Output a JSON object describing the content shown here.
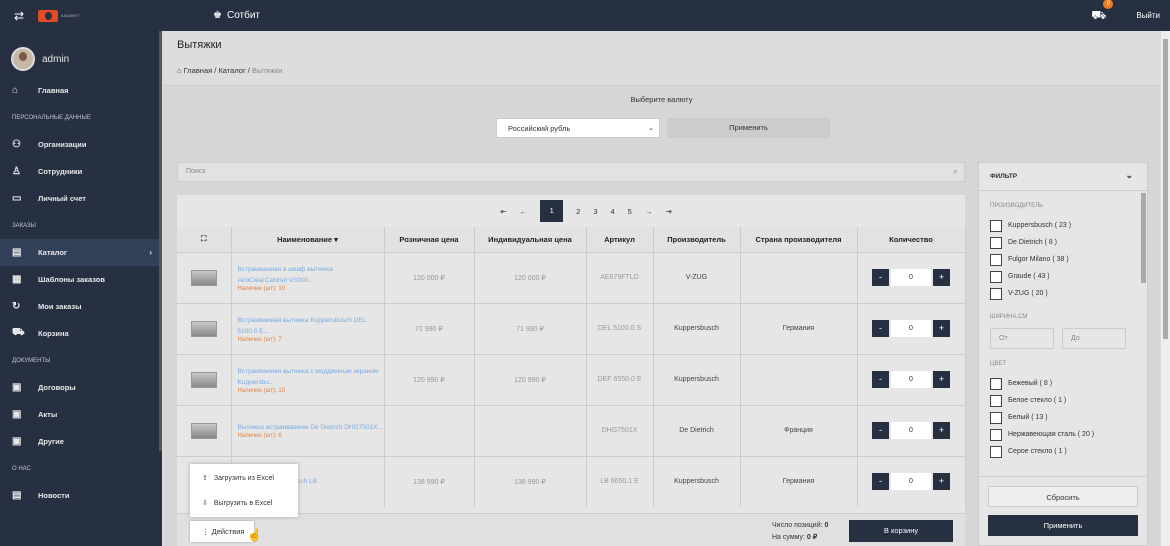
{
  "header": {
    "logo_text": "КАБИНЕТ",
    "company": "Сотбит",
    "cart_count": "0",
    "logout": "Выйти"
  },
  "sidebar": {
    "user": "admin",
    "items": [
      {
        "type": "item",
        "icon": "home-icon",
        "glyph": "⌂",
        "label": "Главная"
      },
      {
        "type": "section",
        "label": "ПЕРСОНАЛЬНЫЕ ДАННЫЕ"
      },
      {
        "type": "item",
        "icon": "org-icon",
        "glyph": "⚇",
        "label": "Организации"
      },
      {
        "type": "item",
        "icon": "person-icon",
        "glyph": "♙",
        "label": "Сотрудники"
      },
      {
        "type": "item",
        "icon": "card-icon",
        "glyph": "▭",
        "label": "Личный счет"
      },
      {
        "type": "section",
        "label": "ЗАКАЗЫ"
      },
      {
        "type": "item",
        "icon": "catalog-icon",
        "glyph": "▤",
        "label": "Каталог",
        "active": true
      },
      {
        "type": "item",
        "icon": "grid-icon",
        "glyph": "▦",
        "label": "Шаблоны заказов"
      },
      {
        "type": "item",
        "icon": "refresh-icon",
        "glyph": "↻",
        "label": "Мои заказы"
      },
      {
        "type": "item",
        "icon": "cart-icon",
        "glyph": "⛟",
        "label": "Корзина"
      },
      {
        "type": "section",
        "label": "ДОКУМЕНТЫ"
      },
      {
        "type": "item",
        "icon": "doc-icon",
        "glyph": "▣",
        "label": "Договоры"
      },
      {
        "type": "item",
        "icon": "doc-icon",
        "glyph": "▣",
        "label": "Акты"
      },
      {
        "type": "item",
        "icon": "doc-icon",
        "glyph": "▣",
        "label": "Другие"
      },
      {
        "type": "section",
        "label": "О НАС"
      },
      {
        "type": "item",
        "icon": "news-icon",
        "glyph": "▤",
        "label": "Новости"
      }
    ]
  },
  "page": {
    "title": "Вытяжки",
    "breadcrumb": [
      "Главная",
      "Каталог",
      "Вытяжки"
    ]
  },
  "currency": {
    "label": "Выберите валюту",
    "selected": "Российский рубль",
    "apply": "Применить"
  },
  "search": {
    "placeholder": "Поиск"
  },
  "pager": [
    "⇤",
    "←",
    "1",
    "2",
    "3",
    "4",
    "5",
    "→",
    "⇥"
  ],
  "table": {
    "headers": [
      "",
      "Наименование ▾",
      "Розничная цена",
      "Индивидуальная цена",
      "Артикул",
      "Производитель",
      "Страна производителя",
      "Количество"
    ],
    "rows": [
      {
        "name": "Встраиваемая в шкаф вытяжка AiroClearCabinet VS000...",
        "avail": "Наличие (шт): 10",
        "retail": "120 000 ₽",
        "indiv": "120 000 ₽",
        "sku": "AE679FTLD",
        "maker": "V-ZUG",
        "country": "",
        "qty": "0"
      },
      {
        "name": "Встраиваемая вытяжка Kuppersbusch DEL 5100.0 E...",
        "avail": "Наличие (шт): 7",
        "retail": "71 990 ₽",
        "indiv": "71 990 ₽",
        "sku": "DEL 5100.0 S",
        "maker": "Kuppersbusch",
        "country": "Германия",
        "qty": "0"
      },
      {
        "name": "Встраиваемая вытяжка с модджиным экраном Kuppersbu...",
        "avail": "Наличие (шт): 10",
        "retail": "120 990 ₽",
        "indiv": "120 990 ₽",
        "sku": "DEF 6550.0 E",
        "maker": "Kuppersbusch",
        "country": "",
        "qty": "0"
      },
      {
        "name": "Вытяжка встраиваемая De Dietrich DHG7501X...",
        "avail": "Наличие (шт): 6",
        "retail": "",
        "indiv": "",
        "sku": "DHG7501X",
        "maker": "De Dietrich",
        "country": "Франция",
        "qty": "0"
      },
      {
        "name": "Вытяжка Kuppersbusch LB",
        "avail": "",
        "retail": "138 990 ₽",
        "indiv": "138 990 ₽",
        "sku": "LB 6650.1 E",
        "maker": "Kuppersbusch",
        "country": "Германия",
        "qty": "0"
      }
    ]
  },
  "bottom": {
    "actions": "Действия",
    "positions": "Число позиций: ",
    "positions_val": "0",
    "sum": "На сумму: ",
    "sum_val": "0 ₽",
    "to_cart": "В корзину"
  },
  "popup": {
    "items": [
      "Загрузить из Excel",
      "Выгрузить в Excel"
    ]
  },
  "filter": {
    "title": "ФИЛЬТР",
    "maker_label": "ПРОИЗВОДИТЕЛЬ",
    "makers": [
      "Kuppersbusch ( 23 )",
      "De Dietrich ( 8 )",
      "Fulgor Milano ( 38 )",
      "Graude ( 43 )",
      "V-ZUG ( 20 )"
    ],
    "width_label": "ШИРИНА,СМ",
    "from": "От",
    "to": "До",
    "color_label": "ЦВЕТ",
    "colors": [
      "Бежевый ( 8 )",
      "Белое стекло ( 1 )",
      "Белый ( 13 )",
      "Нержавеющая сталь ( 20 )",
      "Серое стекло ( 1 )"
    ],
    "reset": "Сбросить",
    "apply": "Применить"
  }
}
